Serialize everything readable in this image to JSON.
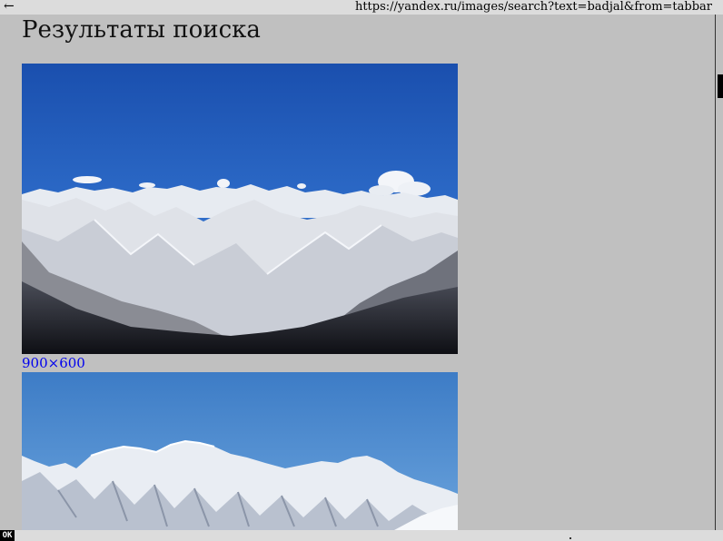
{
  "nav": {
    "back_label": "←",
    "url": "https://yandex.ru/images/search?text=badjal&from=tabbar"
  },
  "page": {
    "title": "Результаты поиска"
  },
  "results": [
    {
      "dimensions": "900×600"
    }
  ],
  "status": {
    "ok_label": "OK"
  }
}
